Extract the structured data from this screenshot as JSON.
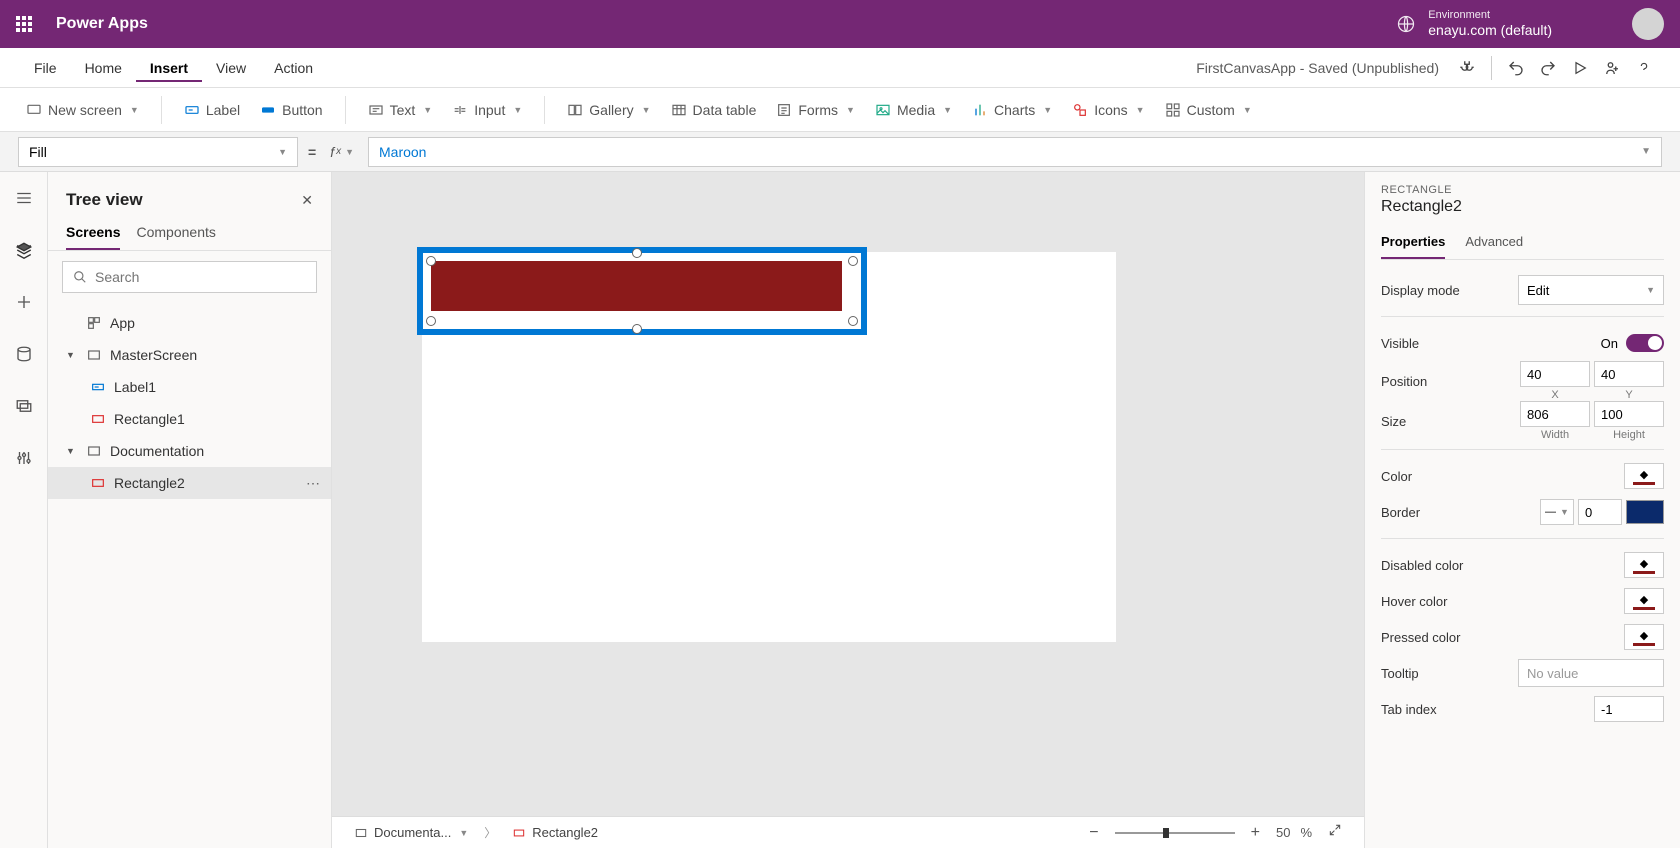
{
  "header": {
    "productName": "Power Apps",
    "envLabel": "Environment",
    "envName": "enayu.com (default)"
  },
  "menuBar": {
    "items": [
      "File",
      "Home",
      "Insert",
      "View",
      "Action"
    ],
    "appStatus": "FirstCanvasApp - Saved (Unpublished)"
  },
  "ribbon": {
    "newScreen": "New screen",
    "label": "Label",
    "button": "Button",
    "text": "Text",
    "input": "Input",
    "gallery": "Gallery",
    "dataTable": "Data table",
    "forms": "Forms",
    "media": "Media",
    "charts": "Charts",
    "icons": "Icons",
    "custom": "Custom"
  },
  "formula": {
    "property": "Fill",
    "value": "Maroon"
  },
  "tree": {
    "title": "Tree view",
    "tabs": [
      "Screens",
      "Components"
    ],
    "searchPlaceholder": "Search",
    "app": "App",
    "masterScreen": "MasterScreen",
    "label1": "Label1",
    "rect1": "Rectangle1",
    "docScreen": "Documentation",
    "rect2": "Rectangle2"
  },
  "props": {
    "type": "Rectangle",
    "name": "Rectangle2",
    "tabs": [
      "Properties",
      "Advanced"
    ],
    "displayMode": {
      "label": "Display mode",
      "value": "Edit"
    },
    "visible": {
      "label": "Visible",
      "value": "On"
    },
    "position": {
      "label": "Position",
      "x": "40",
      "y": "40",
      "xLabel": "X",
      "yLabel": "Y"
    },
    "size": {
      "label": "Size",
      "w": "806",
      "h": "100",
      "wLabel": "Width",
      "hLabel": "Height"
    },
    "color": {
      "label": "Color",
      "value": "#8b1a1a"
    },
    "border": {
      "label": "Border",
      "width": "0",
      "color": "#0b2a6b"
    },
    "disabledColor": {
      "label": "Disabled color",
      "value": "#8b1a1a"
    },
    "hoverColor": {
      "label": "Hover color",
      "value": "#8b1a1a"
    },
    "pressedColor": {
      "label": "Pressed color",
      "value": "#8b1a1a"
    },
    "tooltip": {
      "label": "Tooltip",
      "placeholder": "No value"
    },
    "tabIndex": {
      "label": "Tab index",
      "value": "-1"
    }
  },
  "statusBar": {
    "crumb1": "Documenta...",
    "crumb2": "Rectangle2",
    "zoom": "50",
    "zoomUnit": "%"
  }
}
